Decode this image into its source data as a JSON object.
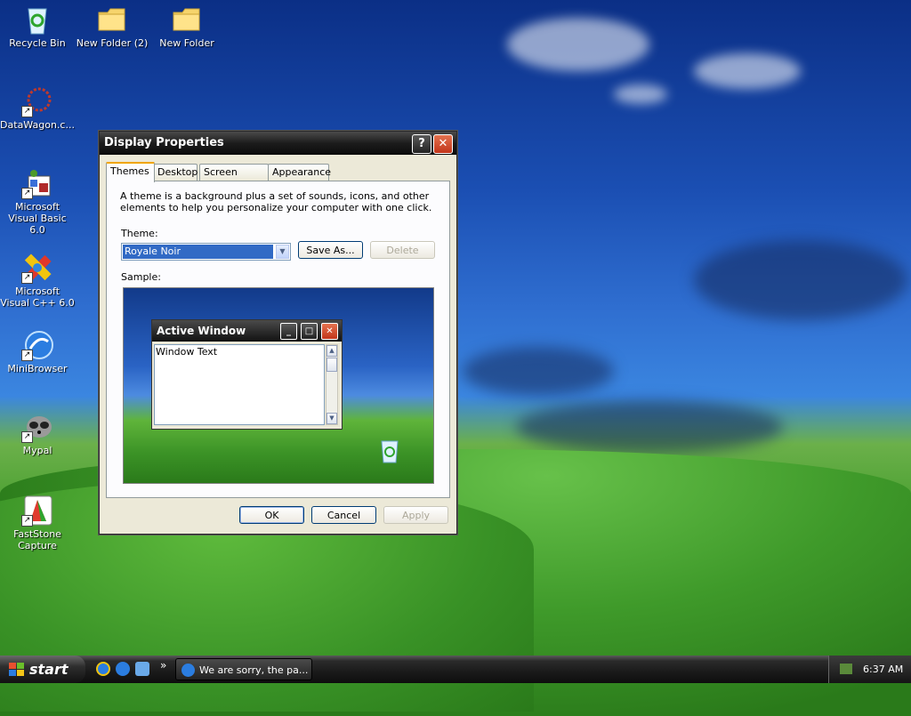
{
  "desktop": {
    "icons": [
      {
        "label": "Recycle Bin",
        "icon": "recycle-bin-icon"
      },
      {
        "label": "New Folder (2)",
        "icon": "folder-icon"
      },
      {
        "label": "New Folder",
        "icon": "folder-icon"
      },
      {
        "label": "DataWagon.c...",
        "icon": "datawagon-icon"
      },
      {
        "label": "Microsoft Visual Basic 6.0",
        "icon": "visual-basic-icon"
      },
      {
        "label": "Microsoft Visual C++ 6.0",
        "icon": "visual-cpp-icon"
      },
      {
        "label": "MiniBrowser",
        "icon": "minibrowser-icon"
      },
      {
        "label": "Mypal",
        "icon": "mypal-icon"
      },
      {
        "label": "FastStone Capture",
        "icon": "faststone-capture-icon"
      }
    ]
  },
  "window": {
    "title": "Display Properties",
    "help_glyph": "?",
    "close_glyph": "✕",
    "tabs": [
      "Themes",
      "Desktop",
      "Screen Saver",
      "Appearance"
    ],
    "active_tab": "Themes",
    "description": "A theme is a background plus a set of sounds, icons, and other elements to help you personalize your computer with one click.",
    "theme_label": "Theme:",
    "theme_value": "Royale Noir",
    "save_as_label": "Save As...",
    "delete_label": "Delete",
    "sample_label": "Sample:",
    "sample_window": {
      "title": "Active Window",
      "text": "Window Text"
    },
    "ok_label": "OK",
    "cancel_label": "Cancel",
    "apply_label": "Apply"
  },
  "taskbar": {
    "start_label": "start",
    "overflow_glyph": "»",
    "task_item_label": "We are sorry, the pa...",
    "clock": "6:37 AM"
  },
  "colors": {
    "accent_tab": "#f0a500",
    "selection": "#316ac5",
    "close_red": "#c2351a"
  }
}
